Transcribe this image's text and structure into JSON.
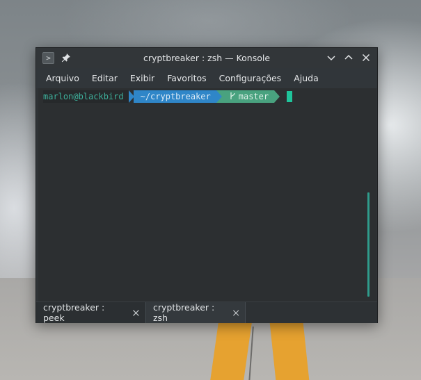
{
  "window": {
    "title": "cryptbreaker : zsh — Konsole"
  },
  "icons": {
    "app": "konsole-icon",
    "pin": "pin-icon",
    "minimize": "chevron-down-icon",
    "maximize": "chevron-up-icon",
    "close": "close-icon",
    "git_branch": "git-branch-icon"
  },
  "menubar": {
    "items": [
      "Arquivo",
      "Editar",
      "Exibir",
      "Favoritos",
      "Configurações",
      "Ajuda"
    ]
  },
  "terminal": {
    "prompt_user": "marlon@blackbird",
    "prompt_path": "~/cryptbreaker",
    "git_branch": "master"
  },
  "tabs": [
    {
      "label": "cryptbreaker : peek"
    },
    {
      "label": "cryptbreaker : zsh"
    }
  ],
  "colors": {
    "prompt_user": "#3daf9a",
    "prompt_path_bg": "#2f86c8",
    "prompt_git_bg": "#49a27f",
    "cursor": "#1fc49b",
    "terminal_bg": "#2c2f31"
  }
}
